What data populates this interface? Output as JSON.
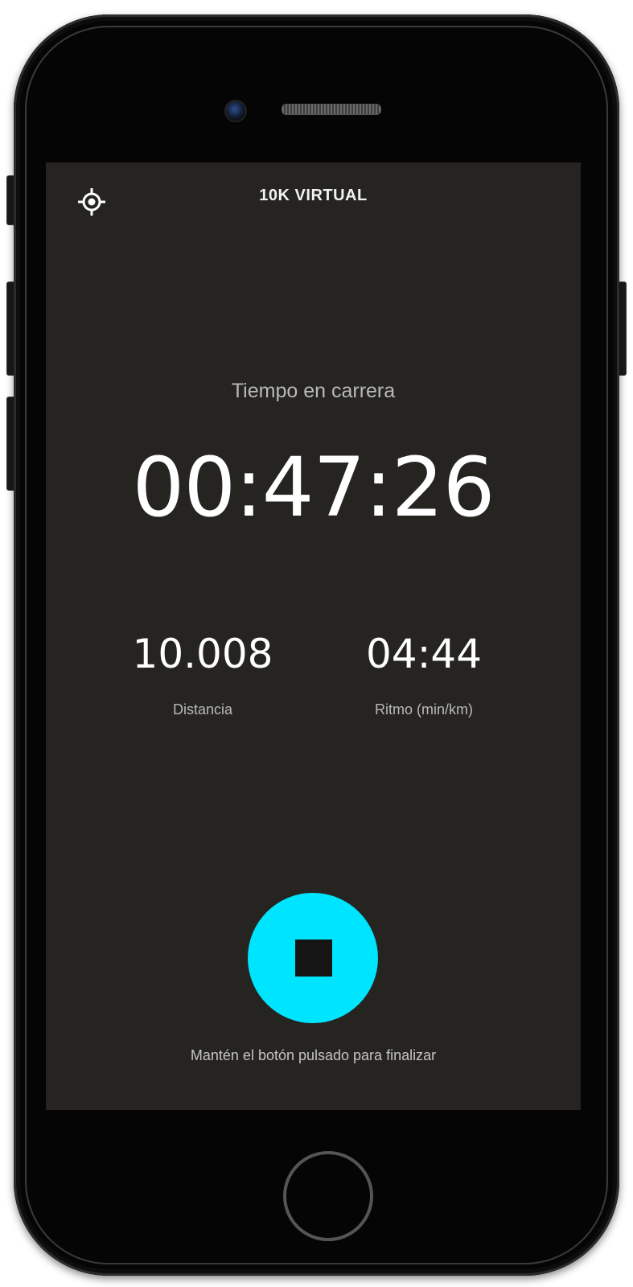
{
  "header": {
    "title": "10K VIRTUAL",
    "locate_icon": "crosshair-location-icon"
  },
  "timer": {
    "label": "Tiempo en carrera",
    "value": "00:47:26"
  },
  "stats": {
    "distance": {
      "value": "10.008",
      "label": "Distancia"
    },
    "pace": {
      "value": "04:44",
      "label": "Ritmo (min/km)"
    }
  },
  "controls": {
    "stop_icon": "stop-icon",
    "hint": "Mantén el botón pulsado para finalizar"
  },
  "colors": {
    "screen_background": "#252420",
    "accent": "#00e5ff",
    "text_primary": "#ffffff",
    "text_secondary": "#b9b9b6"
  }
}
